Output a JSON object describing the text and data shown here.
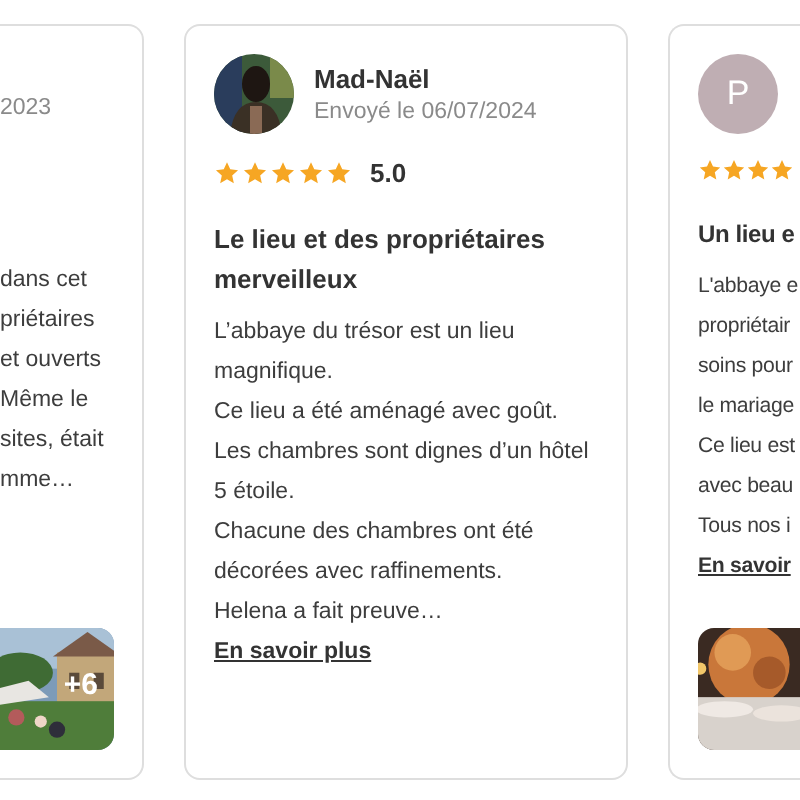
{
  "reviews": [
    {
      "kind": "cut-left",
      "date": "2023",
      "lines": [
        "dans cet",
        "priétaires",
        "et ouverts",
        "Même le",
        "sites, était",
        "mme…"
      ],
      "photo_count": "+6"
    },
    {
      "kind": "full",
      "name": "Mad-Naël",
      "date": "Envoyé le 06/07/2024",
      "stars": 5,
      "rating": "5.0",
      "title": "Le lieu et des propriétaires merveilleux",
      "paragraphs": [
        "L’abbaye du trésor est un lieu magnifique.",
        "Ce lieu a été aménagé avec goût.",
        "Les chambres sont dignes d’un hôtel 5 étoile.",
        "Chacune des chambres ont été décorées avec raffinements.",
        "Helena a fait preuve…"
      ],
      "link": "En savoir plus"
    },
    {
      "kind": "cut-right",
      "initial": "P",
      "stars": 4,
      "title": "Un lieu e",
      "lines": [
        "L'abbaye e",
        "propriétair",
        "soins pour",
        "le mariage",
        "Ce lieu est",
        "avec beau",
        "Tous nos i"
      ],
      "link": "En savoir"
    }
  ]
}
